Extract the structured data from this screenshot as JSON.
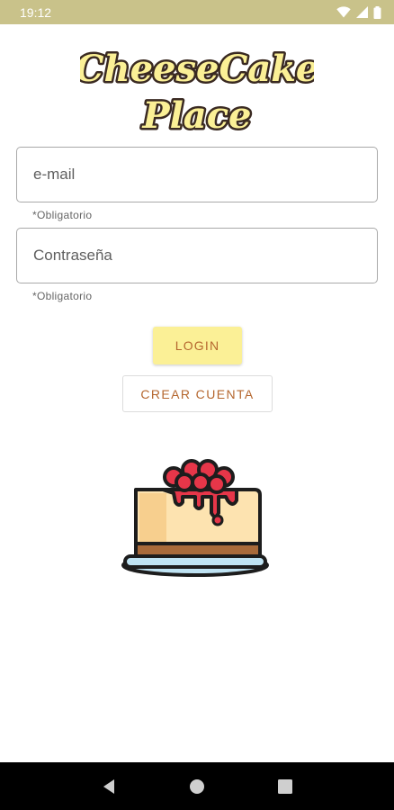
{
  "status_bar": {
    "time": "19:12",
    "icons": [
      "wifi-icon",
      "signal-icon",
      "battery-icon"
    ],
    "background": "#c9c28a"
  },
  "logo": {
    "line1": "CheeseCake",
    "line2": "Place",
    "fill_color": "#fbf096",
    "outline_color": "#3a2a22"
  },
  "login_form": {
    "email_placeholder": "e-mail",
    "email_helper": "*Obligatorio",
    "password_placeholder": "Contraseña",
    "password_helper": "*Obligatorio"
  },
  "buttons": {
    "login_label": "LOGIN",
    "create_account_label": "CREAR CUENTA",
    "accent_color": "#b5672f",
    "login_background": "#fbf096"
  },
  "illustration": {
    "icon": "cheesecake-icon"
  },
  "nav_bar": {
    "icons": [
      "back-icon",
      "home-icon",
      "recents-icon"
    ]
  }
}
